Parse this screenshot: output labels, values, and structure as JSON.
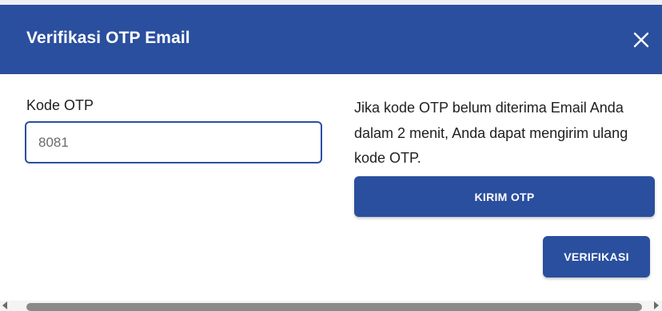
{
  "dialog": {
    "title": "Verifikasi OTP Email",
    "close_icon": "close-icon"
  },
  "otp": {
    "label": "Kode OTP",
    "value": "8081"
  },
  "info": {
    "message": "Jika kode OTP belum diterima Email Anda dalam 2 menit, Anda dapat mengirim ulang kode OTP."
  },
  "buttons": {
    "resend_label": "KIRIM OTP",
    "verify_label": "VERIFIKASI"
  },
  "colors": {
    "primary": "#2a4f9e",
    "text": "#1f1f1f",
    "input_text": "#6b6b6b"
  }
}
